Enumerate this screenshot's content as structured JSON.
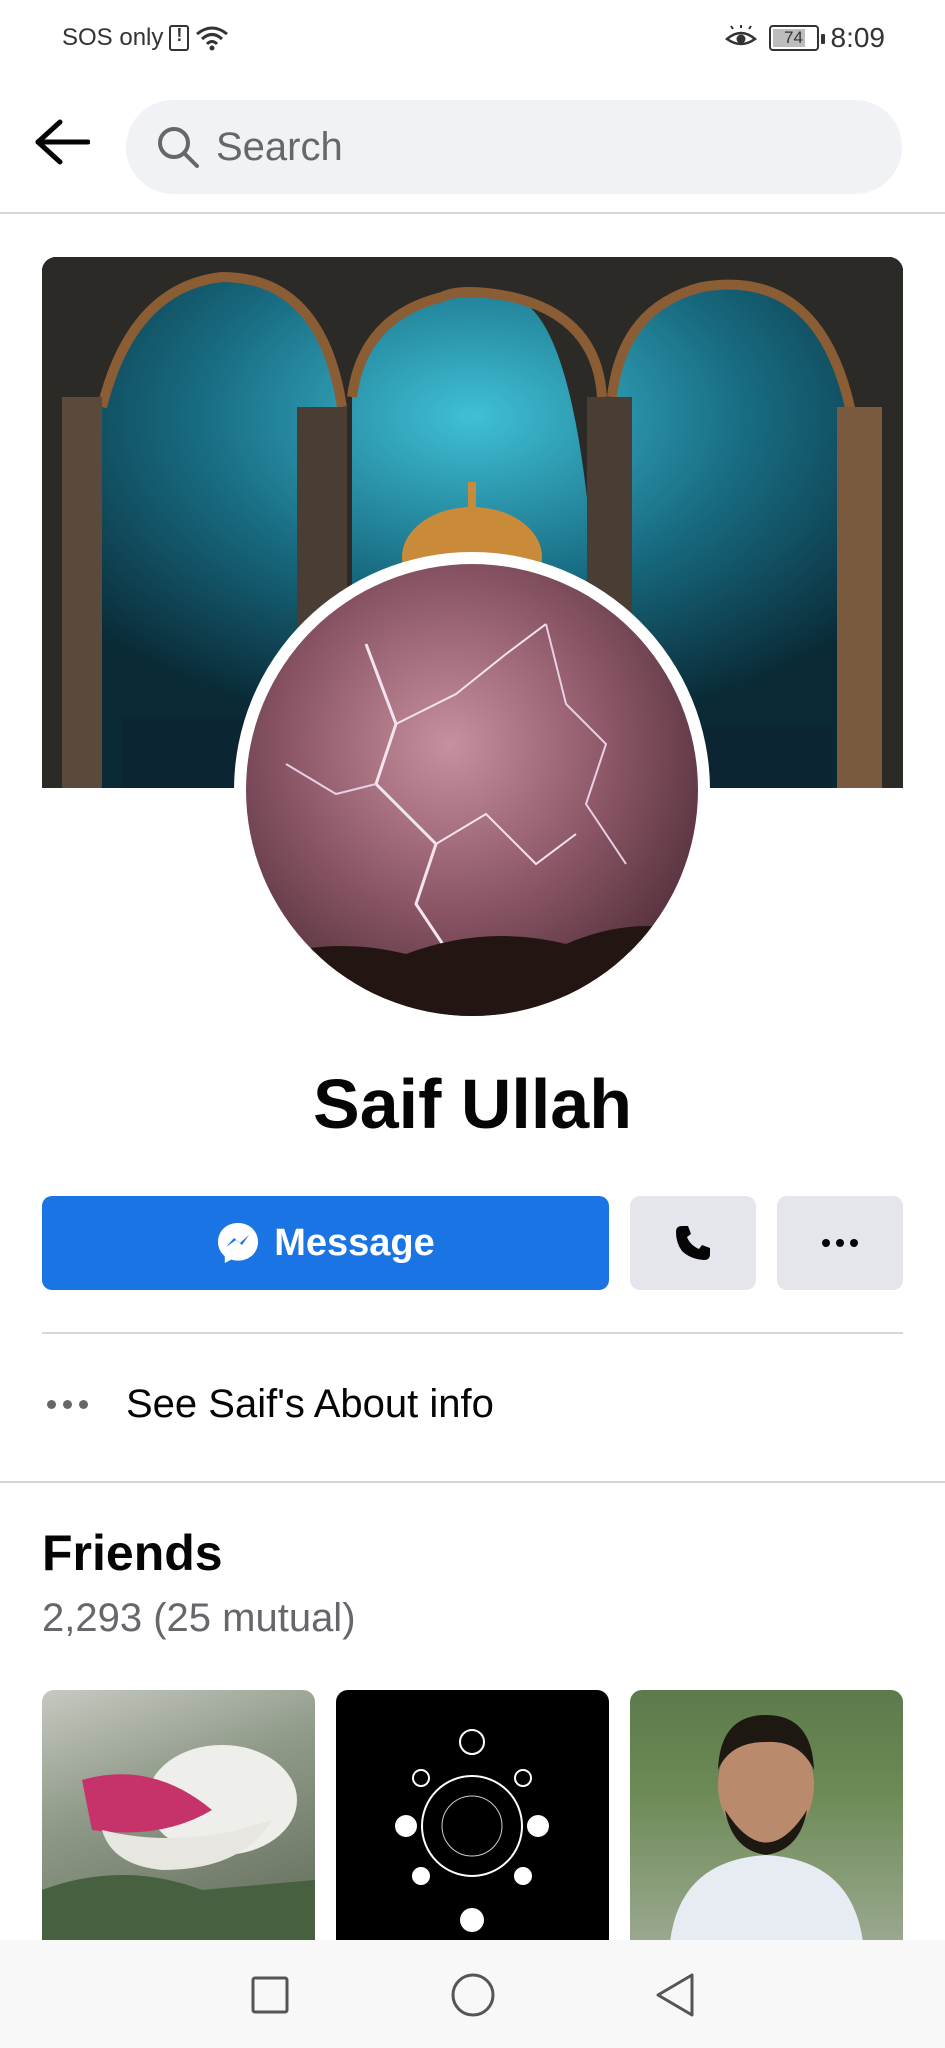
{
  "status_bar": {
    "carrier": "SOS only",
    "battery": "74",
    "time": "8:09"
  },
  "top_nav": {
    "search_placeholder": "Search"
  },
  "profile": {
    "name": "Saif Ullah"
  },
  "actions": {
    "message_label": "Message",
    "call_icon": "phone-icon",
    "more_icon": "more-dots-icon"
  },
  "about": {
    "label": "See Saif's About info"
  },
  "friends": {
    "title": "Friends",
    "count": "2,293 (25 mutual)"
  },
  "colors": {
    "primary_blue": "#1b74e4",
    "secondary_gray": "#e4e6eb",
    "text_secondary": "#65676b"
  }
}
